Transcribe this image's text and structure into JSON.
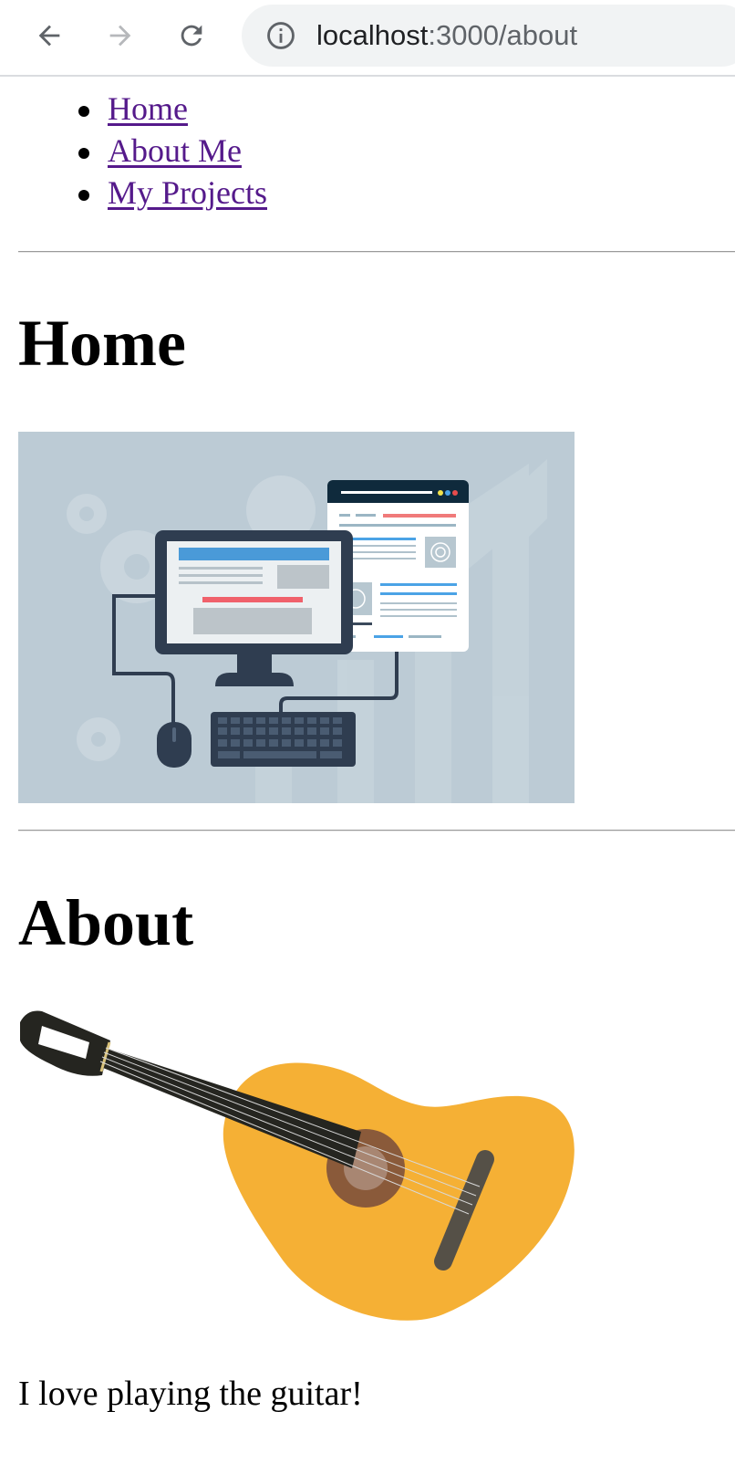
{
  "browser": {
    "url_host": "localhost",
    "url_path": ":3000/about",
    "icons": {
      "back": "back-arrow-icon",
      "forward": "forward-arrow-icon",
      "reload": "reload-icon",
      "site_info": "info-icon"
    }
  },
  "nav": {
    "items": [
      {
        "label": "Home"
      },
      {
        "label": "About Me"
      },
      {
        "label": "My Projects"
      }
    ]
  },
  "home": {
    "heading": "Home",
    "image_icon": "computer-workstation-illustration"
  },
  "about": {
    "heading": "About",
    "image_icon": "guitar-illustration",
    "text": "I love playing the guitar!"
  },
  "colors": {
    "link": "#551a8b",
    "hero_bg": "#bccbd5",
    "guitar_body": "#f5b035",
    "monitor_frame": "#2f3d50"
  }
}
